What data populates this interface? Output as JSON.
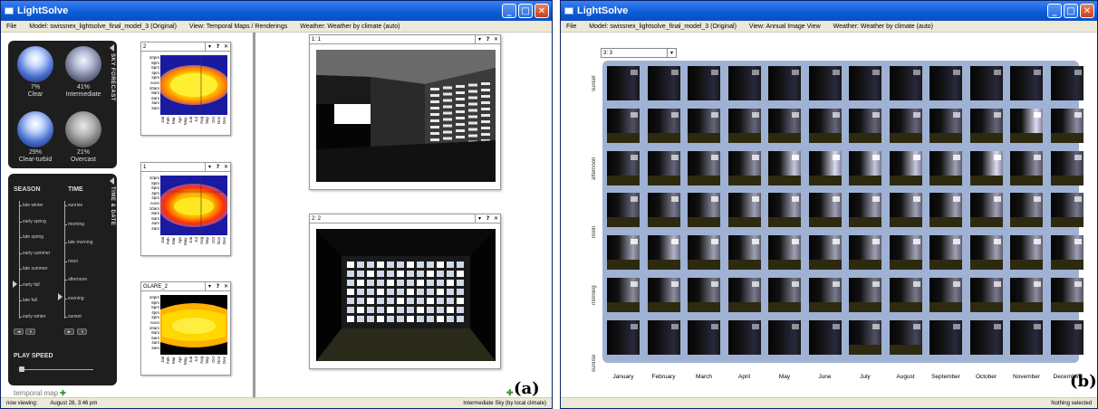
{
  "window_a": {
    "title": "LightSolve",
    "menu": [
      "File",
      "Model: swissnex_lightsolve_final_model_3 (Original)",
      "View: Temporal Maps / Renderings",
      "Weather: Weather by climate (auto)"
    ],
    "sky_forecast": {
      "label": "SKY FORECAST",
      "items": [
        {
          "pct": "7%",
          "name": "Clear",
          "icon": "clear-sky-sphere"
        },
        {
          "pct": "41%",
          "name": "Intermediate",
          "icon": "intermediate-sky-sphere"
        },
        {
          "pct": "29%",
          "name": "Clear-turbid",
          "icon": "clear-turbid-sky-sphere"
        },
        {
          "pct": "21%",
          "name": "Overcast",
          "icon": "overcast-sky-sphere"
        }
      ]
    },
    "time_date": {
      "label": "TIME & DATE",
      "season_header": "SEASON",
      "time_header": "TIME",
      "seasons": [
        "late winter",
        "early spring",
        "late spring",
        "early summer",
        "late summer",
        "early fall",
        "late fall",
        "early winter"
      ],
      "times": [
        "sunrise",
        "morning",
        "late morning",
        "noon",
        "afternoon",
        "evening",
        "sunset"
      ],
      "play_speed_label": "PLAY SPEED",
      "season_selected": "early fall",
      "time_selected": "evening"
    },
    "temporal_maps": [
      {
        "selector": "2"
      },
      {
        "selector": "1"
      },
      {
        "selector": "GLARE_2"
      }
    ],
    "hour_labels": [
      "10pm",
      "8pm",
      "6pm",
      "4pm",
      "2pm",
      "noon",
      "10am",
      "8am",
      "6am",
      "4am",
      "2am"
    ],
    "month_labels": [
      "Jan",
      "Feb",
      "Mar",
      "Apr",
      "May",
      "Jun",
      "Jul",
      "Aug",
      "Sep",
      "Oct",
      "Nov",
      "Dec"
    ],
    "renderings": [
      {
        "selector": "1: 1"
      },
      {
        "selector": "2: 2"
      }
    ],
    "temporal_map_link": "temporal map",
    "status_left": "now viewing:",
    "status_date": "August 28,  3:46 pm",
    "status_right": "Intermediate Sky (by local climate)",
    "panel_label": "(a)"
  },
  "window_b": {
    "title": "LightSolve",
    "menu": [
      "File",
      "Model: swissnex_lightsolve_final_model_3 (Original)",
      "View: Annual Image View",
      "Weather: Weather by climate (auto)"
    ],
    "selector": "3: 3",
    "row_labels": [
      "sunset",
      "afternoon",
      "noon",
      "morning",
      "sunrise"
    ],
    "months": [
      "January",
      "February",
      "March",
      "April",
      "May",
      "June",
      "July",
      "August",
      "September",
      "October",
      "November",
      "December"
    ],
    "status_right": "Nothing selected",
    "panel_label": "(b)"
  },
  "colors": {
    "titlebar": "#0a5bd6",
    "panel_bg": "#1e1e1e",
    "grid_bg": "#9fb2d4",
    "accent_green": "#2e9a2e"
  }
}
